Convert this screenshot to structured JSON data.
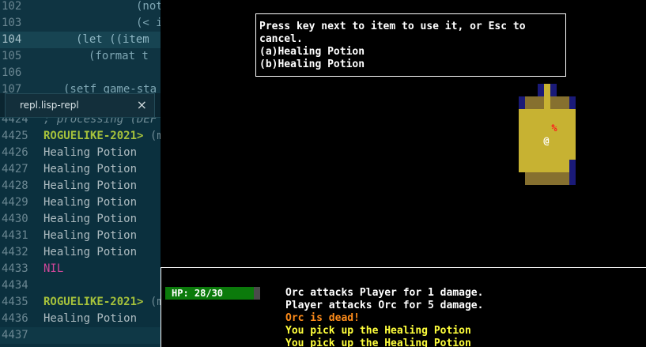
{
  "editor": {
    "lines": [
      {
        "num": "102",
        "code": "(not"
      },
      {
        "num": "103",
        "code": "(< i"
      },
      {
        "num": "104",
        "code": "(let ((item"
      },
      {
        "num": "105",
        "code": "(format t"
      },
      {
        "num": "106",
        "code": ""
      },
      {
        "num": "107",
        "code": "(setf game-sta"
      }
    ]
  },
  "tab": {
    "title": "repl.lisp-repl",
    "close": "×"
  },
  "repl": {
    "partial_line": {
      "num": "4424",
      "text": "; processing (DEF"
    },
    "lines": [
      {
        "num": "4425",
        "prompt": "ROGUELIKE-2021>",
        "text": " (m"
      },
      {
        "num": "4426",
        "text": "Healing Potion"
      },
      {
        "num": "4427",
        "text": "Healing Potion"
      },
      {
        "num": "4428",
        "text": "Healing Potion"
      },
      {
        "num": "4429",
        "text": "Healing Potion"
      },
      {
        "num": "4430",
        "text": "Healing Potion"
      },
      {
        "num": "4431",
        "text": "Healing Potion"
      },
      {
        "num": "4432",
        "text": "Healing Potion"
      },
      {
        "num": "4433",
        "nil": "NIL"
      },
      {
        "num": "4434",
        "text": ""
      },
      {
        "num": "4435",
        "prompt": "ROGUELIKE-2021>",
        "text": " (m"
      },
      {
        "num": "4436",
        "text": "Healing Potion"
      },
      {
        "num": "4437",
        "text": ""
      }
    ]
  },
  "dialog": {
    "line1": "Press key next to item to use it, or Esc to",
    "line2": "cancel.",
    "option_a": "(a)Healing Potion",
    "option_b": "(b)Healing Potion"
  },
  "map": {
    "item_glyph": "%",
    "player_glyph": "@",
    "colors": {
      "floor_lit": "#c7b232",
      "floor_dark": "#86702f",
      "wall": "#1a1a78",
      "item": "#ff1a1a",
      "player": "#ffffff"
    }
  },
  "status": {
    "hp_label": "HP: 28/30",
    "hp": 28,
    "hp_max": 30
  },
  "messages": [
    {
      "text": "Orc attacks Player for 1 damage.",
      "color": "#ffffff"
    },
    {
      "text": "Player attacks Orc for 5 damage.",
      "color": "#ffffff"
    },
    {
      "text": "Orc is dead!",
      "color": "#ff8c1a"
    },
    {
      "text": "You pick up the Healing Potion",
      "color": "#ffff3c"
    },
    {
      "text": "You pick up the Healing Potion",
      "color": "#ffff3c"
    }
  ]
}
